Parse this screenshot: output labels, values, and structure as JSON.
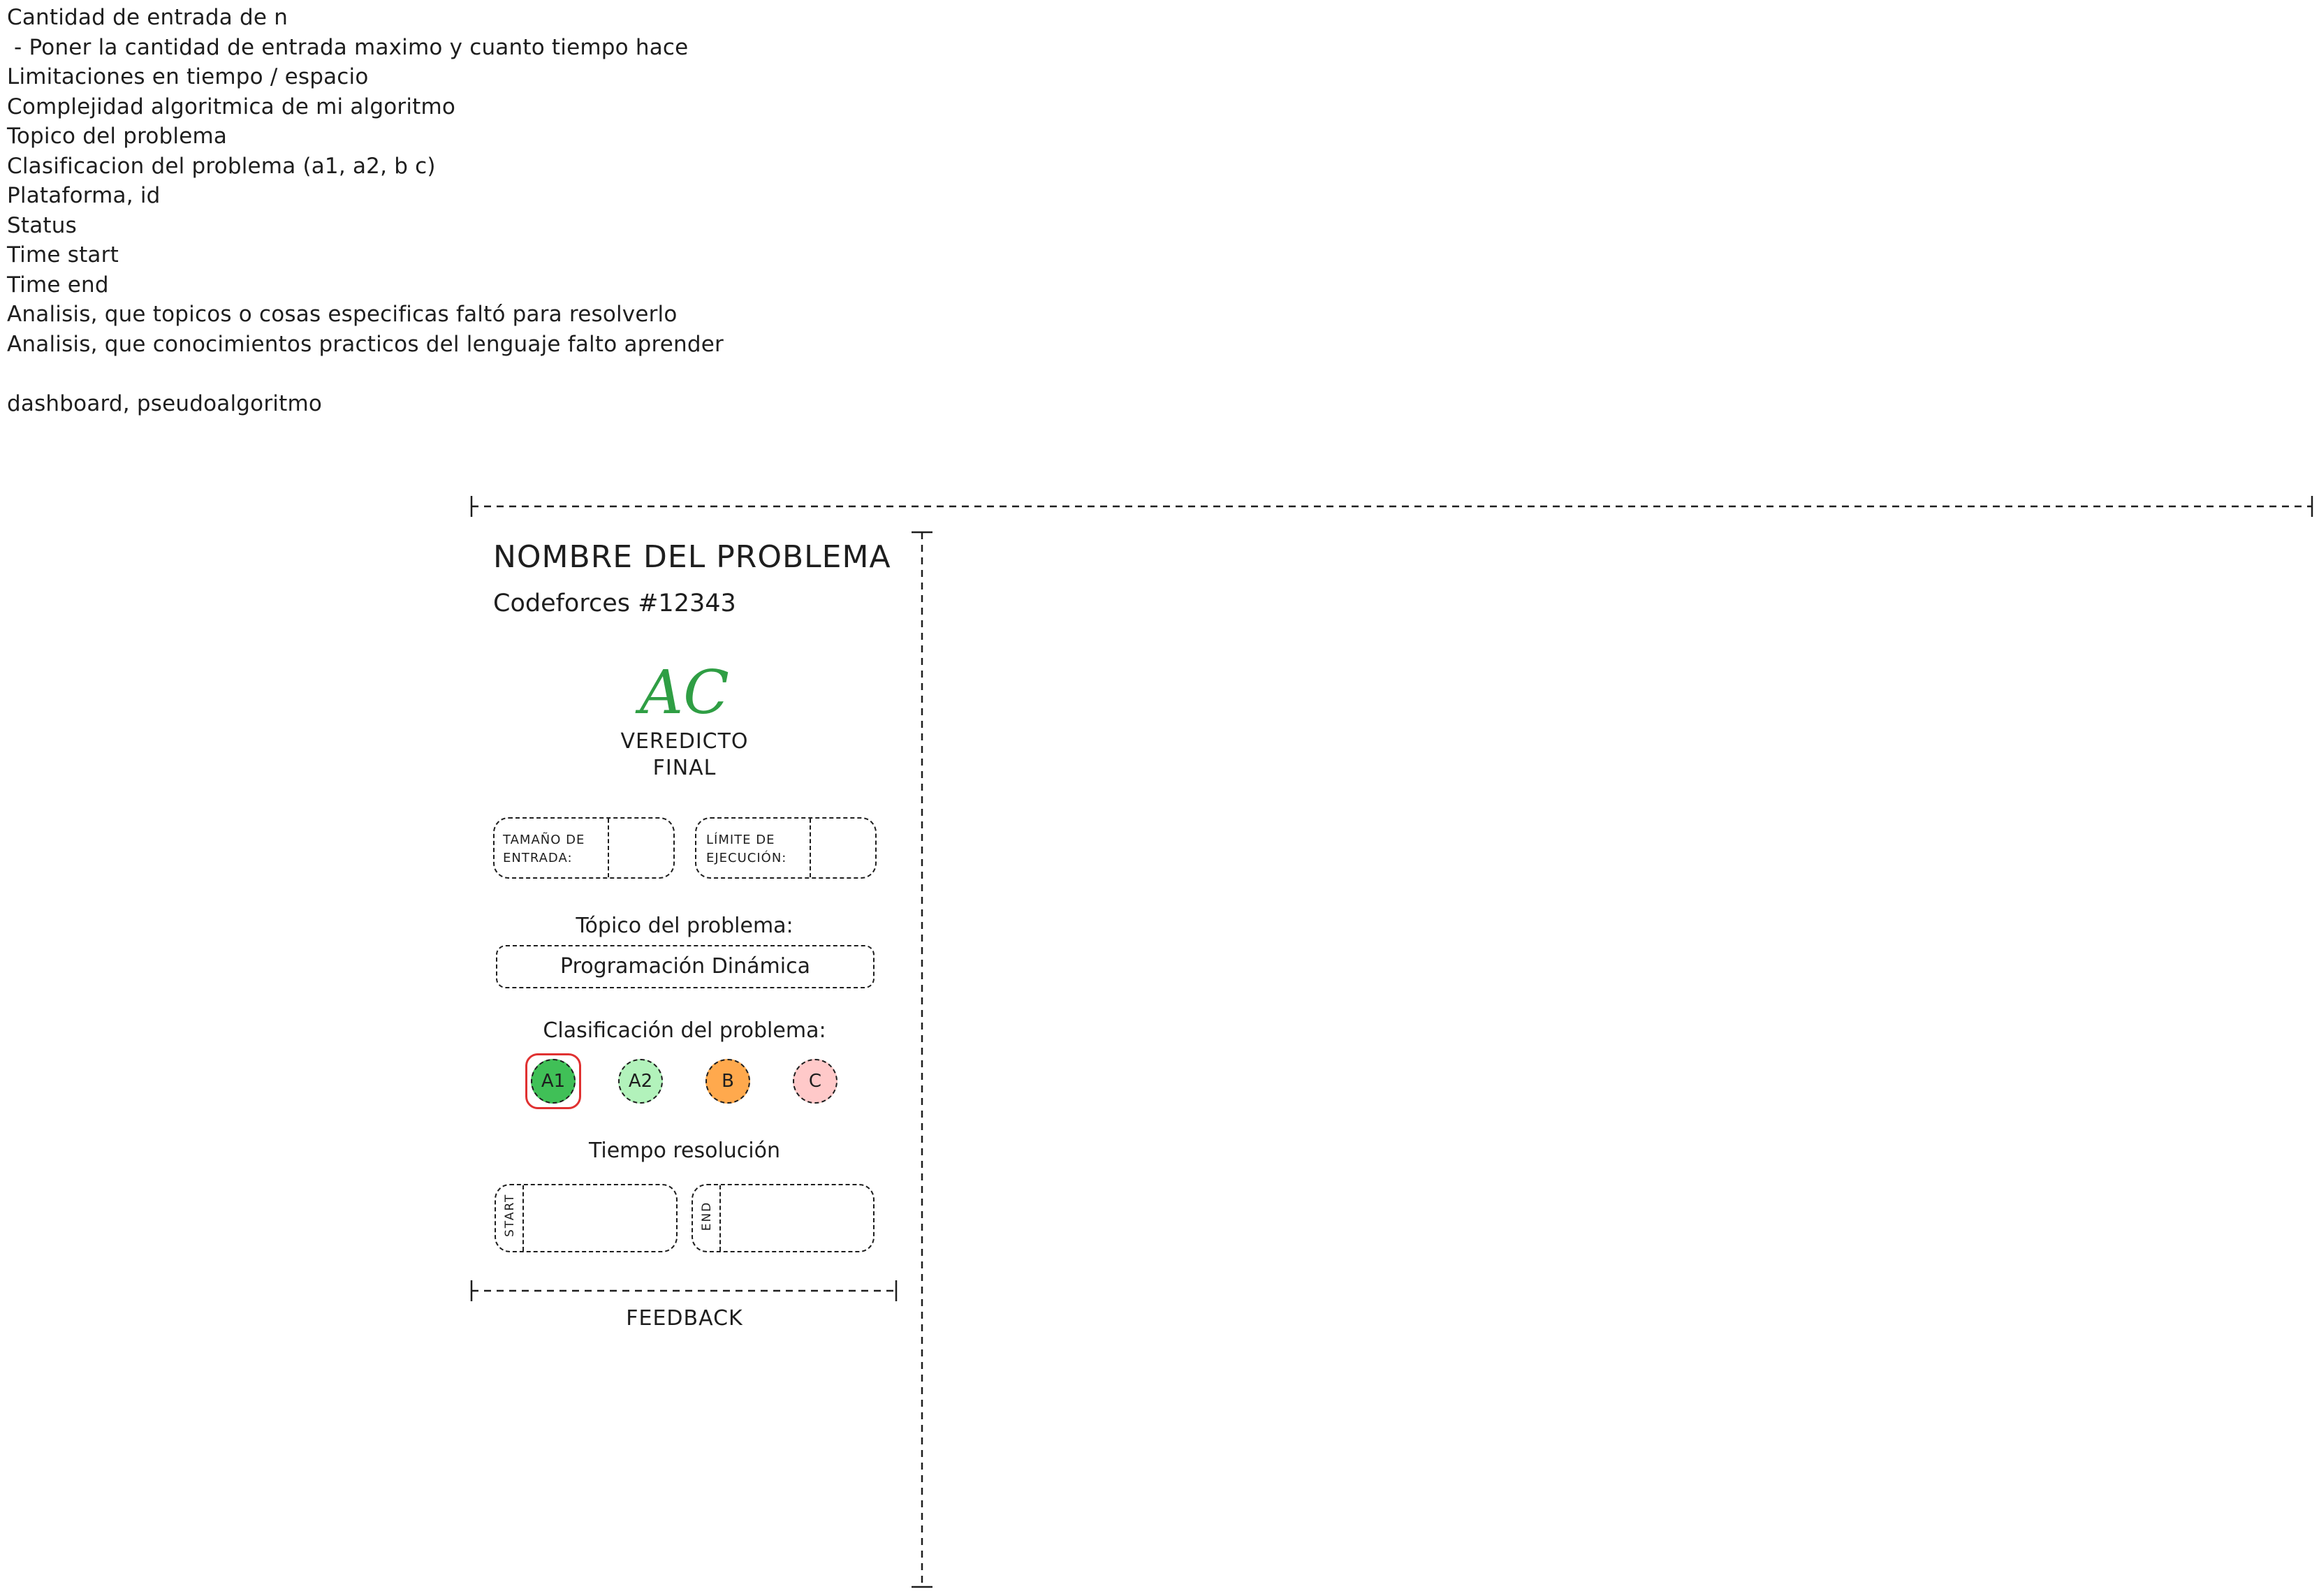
{
  "notes": [
    "Cantidad de entrada de n",
    " - Poner la cantidad de entrada maximo y cuanto tiempo hace",
    "Limitaciones en tiempo / espacio",
    "Complejidad algoritmica de mi algoritmo",
    "Topico del problema",
    "Clasificacion del problema (a1, a2, b c)",
    "Plataforma, id",
    "Status",
    "Time start",
    "Time end",
    "Analisis, que topicos o cosas especificas faltó para resolverlo",
    "Analisis, que conocimientos practicos del lenguaje falto aprender",
    "",
    "dashboard, pseudoalgoritmo"
  ],
  "card": {
    "title": "NOMBRE DEL PROBLEMA",
    "platform_id": "Codeforces #12343",
    "verdict": "AC",
    "verdict_label_1": "VEREDICTO",
    "verdict_label_2": "FINAL",
    "input_size_label_1": "TAMAÑO DE",
    "input_size_label_2": "ENTRADA:",
    "time_limit_label_1": "LÍMITE DE",
    "time_limit_label_2": "EJECUCIÓN:",
    "topic_heading": "Tópico del problema:",
    "topic_value": "Programación Dinámica",
    "classification_heading": "Clasificación del problema:",
    "classes": [
      {
        "label": "A1",
        "color": "#40c057",
        "selected": true
      },
      {
        "label": "A2",
        "color": "#b2f2bb",
        "selected": false
      },
      {
        "label": "B",
        "color": "#ffa94d",
        "selected": false
      },
      {
        "label": "C",
        "color": "#ffc9c9",
        "selected": false
      }
    ],
    "time_heading": "Tiempo resolución",
    "start_label": "START",
    "end_label": "END",
    "feedback_label": "FEEDBACK"
  },
  "colors": {
    "ink": "#1e1e1e",
    "verdict_green": "#2f9e44",
    "selection_red": "#e03131"
  }
}
